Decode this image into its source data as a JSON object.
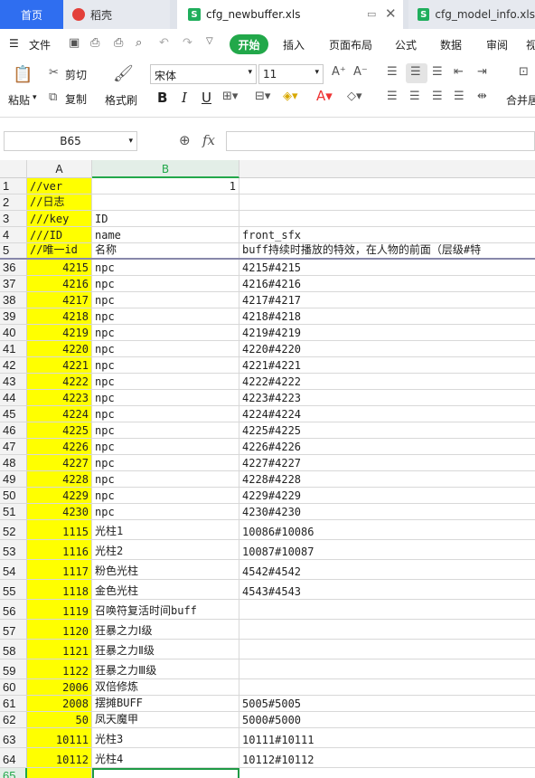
{
  "tabs": {
    "home": "首页",
    "daoke": "稻壳",
    "active": "cfg_newbuffer.xls",
    "model": "cfg_model_info.xls"
  },
  "menu": {
    "file": "文件",
    "start": "开始",
    "insert": "插入",
    "layout": "页面布局",
    "formula": "公式",
    "data": "数据",
    "review": "审阅",
    "more": "视"
  },
  "ribbon": {
    "paste": "粘贴",
    "cut": "剪切",
    "copy": "复制",
    "format_painter": "格式刷",
    "font_name": "宋体",
    "font_size": "11",
    "bold": "B",
    "italic": "I",
    "underline": "U",
    "merge": "合并居"
  },
  "formula_bar": {
    "name_box": "B65",
    "fx_label": "fx",
    "value": ""
  },
  "columns": {
    "a": "A",
    "b": "B"
  },
  "colors": {
    "accent": "#22a84a",
    "highlight": "#ffff00",
    "home_tab": "#2f6ef0"
  },
  "rows": [
    {
      "n": "1",
      "a": "//ver",
      "b": "1",
      "c": "",
      "bnum": true
    },
    {
      "n": "2",
      "a": "//日志",
      "b": "",
      "c": ""
    },
    {
      "n": "3",
      "a": "///key",
      "b": "ID",
      "c": ""
    },
    {
      "n": "4",
      "a": "///ID",
      "b": "name",
      "c": "front_sfx"
    },
    {
      "n": "5",
      "a": "//唯一id",
      "b": "名称",
      "c": "buff持续时播放的特效，在人物的前面（层级#特"
    },
    {
      "n": "36",
      "a": "4215",
      "b": "npc",
      "c": "4215#4215",
      "anum": true
    },
    {
      "n": "37",
      "a": "4216",
      "b": "npc",
      "c": "4216#4216",
      "anum": true
    },
    {
      "n": "38",
      "a": "4217",
      "b": "npc",
      "c": "4217#4217",
      "anum": true
    },
    {
      "n": "39",
      "a": "4218",
      "b": "npc",
      "c": "4218#4218",
      "anum": true
    },
    {
      "n": "40",
      "a": "4219",
      "b": "npc",
      "c": "4219#4219",
      "anum": true
    },
    {
      "n": "41",
      "a": "4220",
      "b": "npc",
      "c": "4220#4220",
      "anum": true
    },
    {
      "n": "42",
      "a": "4221",
      "b": "npc",
      "c": "4221#4221",
      "anum": true
    },
    {
      "n": "43",
      "a": "4222",
      "b": "npc",
      "c": "4222#4222",
      "anum": true
    },
    {
      "n": "44",
      "a": "4223",
      "b": "npc",
      "c": "4223#4223",
      "anum": true
    },
    {
      "n": "45",
      "a": "4224",
      "b": "npc",
      "c": "4224#4224",
      "anum": true
    },
    {
      "n": "46",
      "a": "4225",
      "b": "npc",
      "c": "4225#4225",
      "anum": true
    },
    {
      "n": "47",
      "a": "4226",
      "b": "npc",
      "c": "4226#4226",
      "anum": true
    },
    {
      "n": "48",
      "a": "4227",
      "b": "npc",
      "c": "4227#4227",
      "anum": true
    },
    {
      "n": "49",
      "a": "4228",
      "b": "npc",
      "c": "4228#4228",
      "anum": true
    },
    {
      "n": "50",
      "a": "4229",
      "b": "npc",
      "c": "4229#4229",
      "anum": true
    },
    {
      "n": "51",
      "a": "4230",
      "b": "npc",
      "c": "4230#4230",
      "anum": true
    },
    {
      "n": "52",
      "a": "1115",
      "b": "光柱1",
      "c": "10086#10086",
      "anum": true,
      "tall": true
    },
    {
      "n": "53",
      "a": "1116",
      "b": "光柱2",
      "c": "10087#10087",
      "anum": true,
      "tall": true
    },
    {
      "n": "54",
      "a": "1117",
      "b": "粉色光柱",
      "c": "4542#4542",
      "anum": true,
      "tall": true
    },
    {
      "n": "55",
      "a": "1118",
      "b": "金色光柱",
      "c": "4543#4543",
      "anum": true,
      "tall": true
    },
    {
      "n": "56",
      "a": "1119",
      "b": "召唤符复活时间buff",
      "c": "",
      "anum": true,
      "tall": true
    },
    {
      "n": "57",
      "a": "1120",
      "b": "狂暴之力Ⅰ级",
      "c": "",
      "anum": true,
      "tall": true
    },
    {
      "n": "58",
      "a": "1121",
      "b": "狂暴之力Ⅱ级",
      "c": "",
      "anum": true,
      "tall": true
    },
    {
      "n": "59",
      "a": "1122",
      "b": "狂暴之力Ⅲ级",
      "c": "",
      "anum": true,
      "tall": true
    },
    {
      "n": "60",
      "a": "2006",
      "b": "双倍修炼",
      "c": "",
      "anum": true
    },
    {
      "n": "61",
      "a": "2008",
      "b": "摆摊BUFF",
      "c": "5005#5005",
      "anum": true
    },
    {
      "n": "62",
      "a": "50",
      "b": "凤天魔甲",
      "c": "5000#5000",
      "anum": true
    },
    {
      "n": "63",
      "a": "10111",
      "b": "光柱3",
      "c": "10111#10111",
      "anum": true,
      "tall": true
    },
    {
      "n": "64",
      "a": "10112",
      "b": "光柱4",
      "c": "10112#10112",
      "anum": true,
      "tall": true
    },
    {
      "n": "65",
      "a": "",
      "b": "",
      "c": ""
    }
  ]
}
